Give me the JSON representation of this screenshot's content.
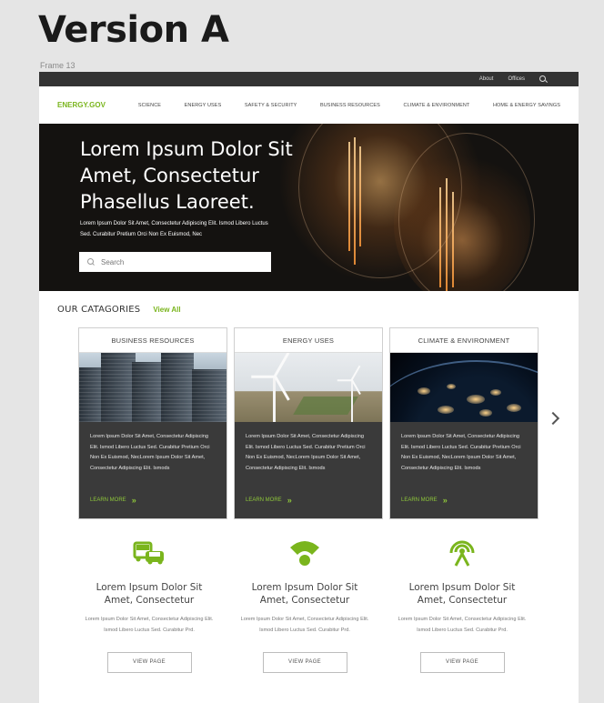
{
  "canvas": {
    "title": "Version A",
    "frame_label": "Frame 13"
  },
  "topbar": {
    "links": [
      "About",
      "Offices"
    ],
    "icon": "search-icon"
  },
  "nav": {
    "logo": "ENERGY.GOV",
    "items": [
      "SCIENCE",
      "ENERGY USES",
      "SAFETY & SECURITY",
      "BUSINESS RESOURCES",
      "CLIMATE & ENVIRONMENT",
      "HOME & ENERGY SAVINGS"
    ]
  },
  "hero": {
    "heading": "Lorem Ipsum Dolor Sit Amet, Consectetur Phasellus Laoreet.",
    "body": "Lorem Ipsum Dolor Sit Amet, Consectetur Adipiscing Elit. Ismod Libero Luctus Sed. Curabitur Pretium Orci Non Ex Euismod, Nec",
    "search_placeholder": "Search"
  },
  "categories": {
    "heading": "OUR CATAGORIES",
    "view_all": "View All",
    "cards": [
      {
        "title": "BUSINESS RESOURCES",
        "image": "skyscrapers-photo",
        "text": "Lorem Ipsum Dolor Sit Amet, Consectetur Adipiscing Elit. Ismod Libero Luctus Sed. Curabitur Pretium Orci Non Ex Euismod, NecLorem Ipsum Dolor Sit Amet, Consectetur Adipiscing Elit. Ismods",
        "link": "LEARN MORE"
      },
      {
        "title": "ENERGY USES",
        "image": "wind-turbine-photo",
        "text": "Lorem Ipsum Dolor Sit Amet, Consectetur Adipiscing Elit. Ismod Libero Luctus Sed. Curabitur Pretium Orci Non Ex Euismod, NecLorem Ipsum Dolor Sit Amet, Consectetur Adipiscing Elit. Ismods",
        "link": "LEARN MORE"
      },
      {
        "title": "CLIMATE & ENVIRONMENT",
        "image": "earth-at-night-photo",
        "text": "Lorem Ipsum Dolor Sit Amet, Consectetur Adipiscing Elit. Ismod Libero Luctus Sed. Curabitur Pretium Orci Non Ex Euismod, NecLorem Ipsum Dolor Sit Amet, Consectetur Adipiscing Elit. Ismods",
        "link": "LEARN MORE"
      }
    ],
    "next_icon": "chevron-right-icon"
  },
  "features": [
    {
      "icon": "vehicles-icon",
      "title": "Lorem Ipsum Dolor Sit Amet, Consectetur",
      "text": "Lorem Ipsum Dolor Sit Amet, Consectetur Adipiscing Elit. Ismod Libero Luctus Sed. Curabitur Prd.",
      "button": "VIEW PAGE"
    },
    {
      "icon": "wifi-signal-icon",
      "title": "Lorem Ipsum Dolor Sit Amet, Consectetur",
      "text": "Lorem Ipsum Dolor Sit Amet, Consectetur Adipiscing Elit. Ismod Libero Luctus Sed. Curabitur Prd.",
      "button": "VIEW PAGE"
    },
    {
      "icon": "broadcast-tower-icon",
      "title": "Lorem Ipsum Dolor Sit Amet, Consectetur",
      "text": "Lorem Ipsum Dolor Sit Amet, Consectetur Adipiscing Elit. Ismod Libero Luctus Sed. Curabitur Prd.",
      "button": "VIEW PAGE"
    }
  ],
  "colors": {
    "accent": "#7ab51d",
    "topbar": "#333333",
    "card_bg": "#3a3a3a",
    "hero_bg": "#141210"
  }
}
